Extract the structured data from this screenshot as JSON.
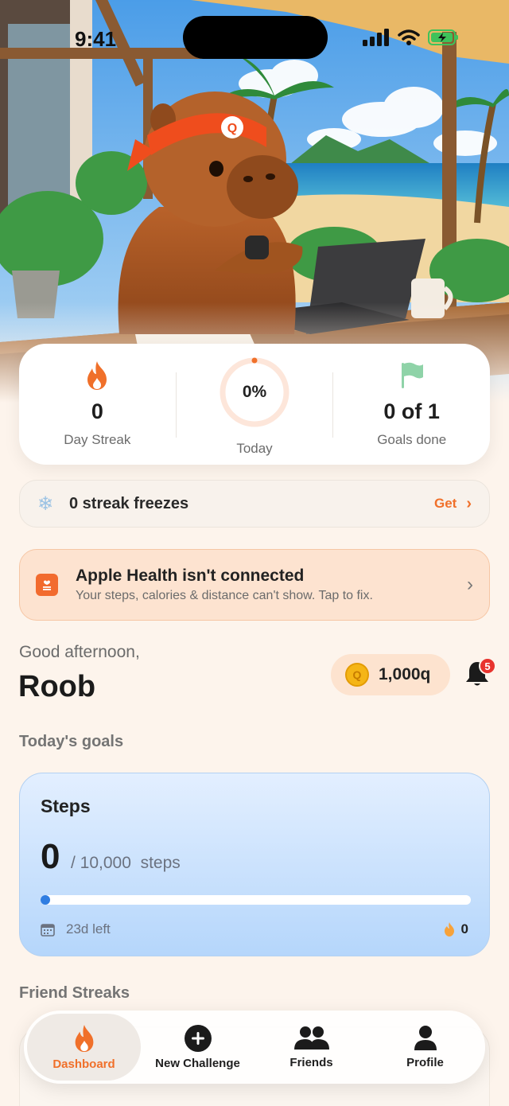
{
  "status_bar": {
    "time": "9:41"
  },
  "stats": {
    "streak": {
      "value": "0",
      "label": "Day Streak"
    },
    "today": {
      "value": "0%",
      "label": "Today",
      "progress": 0
    },
    "goals": {
      "value": "0 of 1",
      "label": "Goals done"
    }
  },
  "freezes": {
    "text": "0 streak freezes",
    "action": "Get"
  },
  "health_banner": {
    "title": "Apple Health isn't connected",
    "subtitle": "Your steps, calories & distance can't show. Tap to fix."
  },
  "greeting": {
    "salutation": "Good afternoon,",
    "name": "Roob"
  },
  "coins": {
    "value": "1,000q",
    "coin_letter": "Q"
  },
  "notifications": {
    "count": "5"
  },
  "goals_section": {
    "title": "Today's goals"
  },
  "goal": {
    "name": "Steps",
    "current": "0",
    "target": "/ 10,000  steps",
    "progress": 0,
    "days_left": "23d left",
    "streak": "0"
  },
  "friends_section": {
    "title": "Friend Streaks"
  },
  "tabbar": {
    "tabs": [
      {
        "label": "Dashboard",
        "icon": "flame-icon",
        "active": true
      },
      {
        "label": "New Challenge",
        "icon": "plus-circle-icon",
        "active": false
      },
      {
        "label": "Friends",
        "icon": "friends-icon",
        "active": false
      },
      {
        "label": "Profile",
        "icon": "person-icon",
        "active": false
      }
    ]
  },
  "colors": {
    "accent": "#f0702a",
    "goal_bar": "#2f7de1",
    "badge": "#e8332e"
  }
}
